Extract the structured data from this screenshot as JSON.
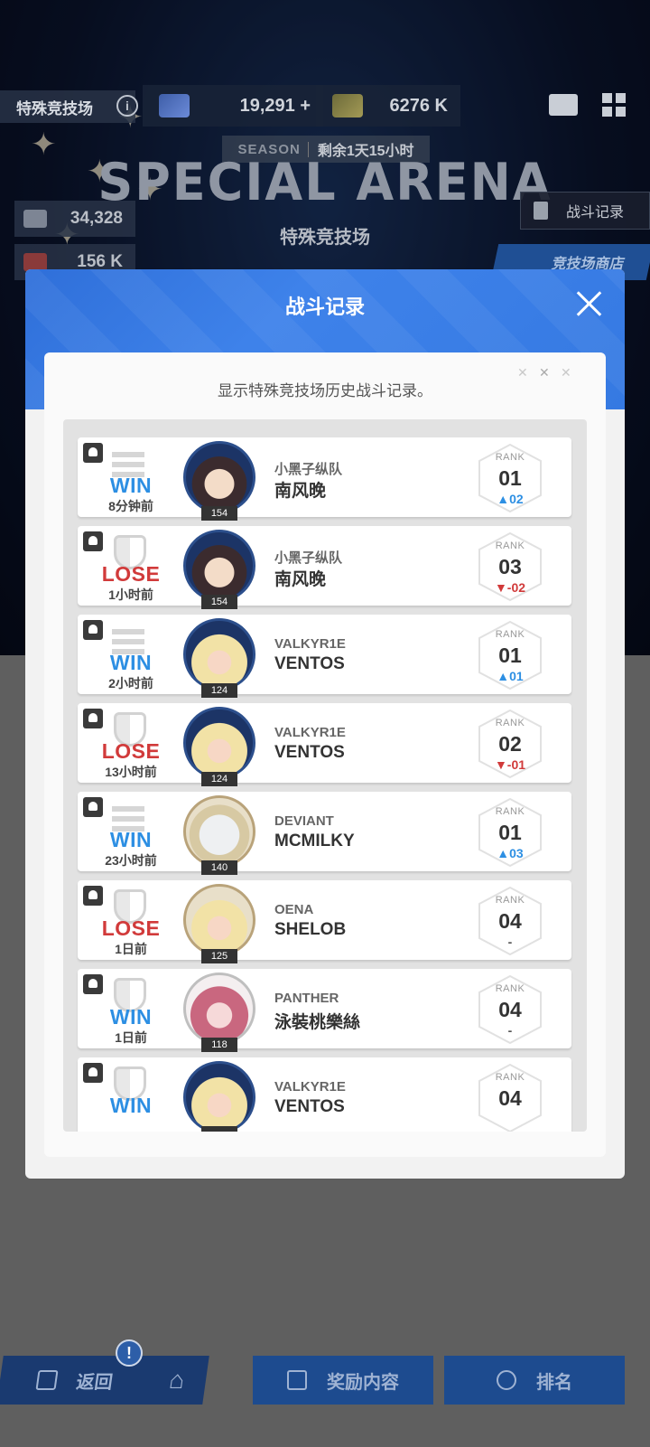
{
  "header": {
    "mode_label": "特殊竞技场",
    "currency1": "19,291",
    "currency1_add": "+",
    "currency2": "6276 K",
    "season_tag": "SEASON",
    "season_remaining": "剩余1天15小时",
    "title": "SPECIAL ARENA",
    "subtitle": "特殊竞技场",
    "stat1": "34,328",
    "stat2": "156 K",
    "record_button": "战斗记录",
    "shop_button": "竞技场商店"
  },
  "modal": {
    "title": "战斗记录",
    "description": "显示特殊竞技场历史战斗记录。",
    "rank_label": "RANK",
    "records": [
      {
        "result": "WIN",
        "time": "8分钟前",
        "level": "154",
        "team": "小黑子纵队",
        "name": "南风晚",
        "rank": "01",
        "change": "▲02",
        "dir": "up",
        "avatar": "dark"
      },
      {
        "result": "LOSE",
        "time": "1小时前",
        "level": "154",
        "team": "小黑子纵队",
        "name": "南风晚",
        "rank": "03",
        "change": "▼-02",
        "dir": "down",
        "avatar": "dark"
      },
      {
        "result": "WIN",
        "time": "2小时前",
        "level": "124",
        "team": "VALKYR1E",
        "name": "VENTOS",
        "rank": "01",
        "change": "▲01",
        "dir": "up",
        "avatar": "blond"
      },
      {
        "result": "LOSE",
        "time": "13小时前",
        "level": "124",
        "team": "VALKYR1E",
        "name": "VENTOS",
        "rank": "02",
        "change": "▼-01",
        "dir": "down",
        "avatar": "blond"
      },
      {
        "result": "WIN",
        "time": "23小时前",
        "level": "140",
        "team": "DEVIANT",
        "name": "MCMILKY",
        "rank": "01",
        "change": "▲03",
        "dir": "up",
        "avatar": "white"
      },
      {
        "result": "LOSE",
        "time": "1日前",
        "level": "125",
        "team": "OENA",
        "name": "SHELOB",
        "rank": "04",
        "change": "-",
        "dir": "same",
        "avatar": "blond2"
      },
      {
        "result": "WIN",
        "time": "1日前",
        "level": "118",
        "team": "PANTHER",
        "name": "泳裝桃樂絲",
        "rank": "04",
        "change": "-",
        "dir": "same",
        "avatar": "pink"
      },
      {
        "result": "WIN",
        "time": "",
        "level": "",
        "team": "VALKYR1E",
        "name": "VENTOS",
        "rank": "04",
        "change": "",
        "dir": "same",
        "avatar": "blond"
      }
    ]
  },
  "footer": {
    "back": "返回",
    "alert": "!",
    "reward": "奖励内容",
    "ranking": "排名"
  },
  "colors": {
    "win": "#2d8fe3",
    "lose": "#d13a3a",
    "modal_header": "#3579e2"
  }
}
